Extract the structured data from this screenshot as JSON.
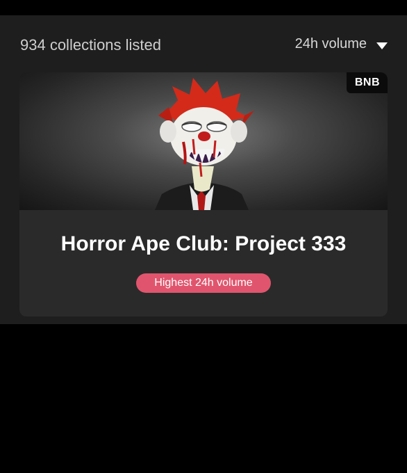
{
  "header": {
    "collection_count_text": "934 collections listed",
    "sort_label": "24h volume"
  },
  "card": {
    "chain_badge": "BNB",
    "title": "Horror Ape Club: Project 333",
    "highlight_tag": "Highest 24h volume",
    "image_icon": "horror-ape-artwork"
  },
  "colors": {
    "panel_bg": "#1e1e1e",
    "card_bg": "#2a2a2a",
    "pill": "#e0556d",
    "badge_bg": "#0b0b0b"
  }
}
